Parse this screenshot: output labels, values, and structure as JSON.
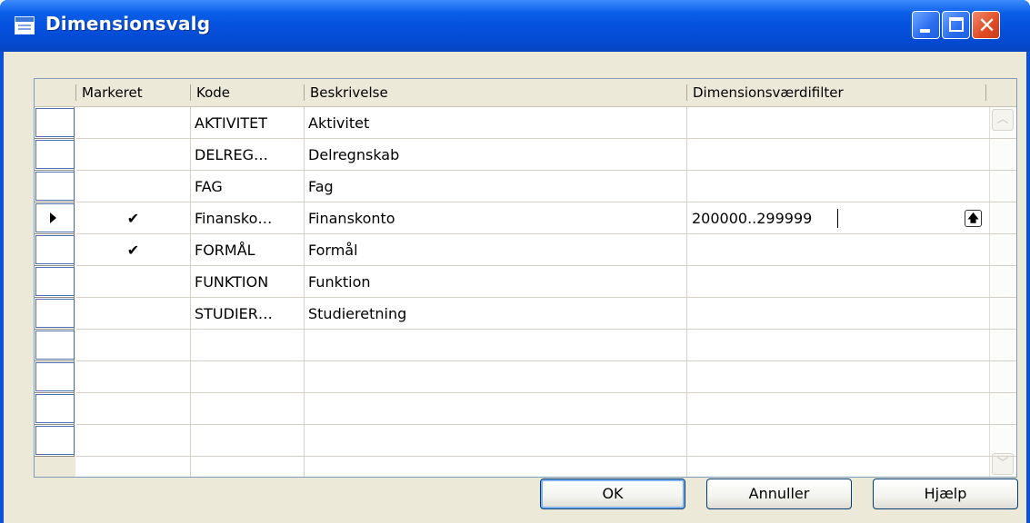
{
  "window": {
    "title": "Dimensionsvalg"
  },
  "grid": {
    "columns": [
      "Markeret",
      "Kode",
      "Beskrivelse",
      "Dimensionsværdifilter"
    ],
    "rows": [
      {
        "marked": "",
        "kode": "AKTIVITET",
        "beskrivelse": "Aktivitet",
        "filter": ""
      },
      {
        "marked": "",
        "kode": "DELREG…",
        "beskrivelse": "Delregnskab",
        "filter": ""
      },
      {
        "marked": "",
        "kode": "FAG",
        "beskrivelse": "Fag",
        "filter": ""
      },
      {
        "marked": "✔",
        "kode": "Finansko…",
        "beskrivelse": "Finanskonto",
        "filter": "200000..299999"
      },
      {
        "marked": "✔",
        "kode": "FORMÅL",
        "beskrivelse": "Formål",
        "filter": ""
      },
      {
        "marked": "",
        "kode": "FUNKTION",
        "beskrivelse": "Funktion",
        "filter": ""
      },
      {
        "marked": "",
        "kode": "STUDIER…",
        "beskrivelse": "Studieretning",
        "filter": ""
      }
    ],
    "current_row_index": 3,
    "lookup_icon": "lookup-up-arrow-icon"
  },
  "buttons": {
    "ok": "OK",
    "cancel": "Annuller",
    "help": "Hjælp"
  },
  "colors": {
    "titlebar": "#0550dc",
    "dialog_bg": "#ece9d8",
    "close_button": "#e04a24"
  }
}
